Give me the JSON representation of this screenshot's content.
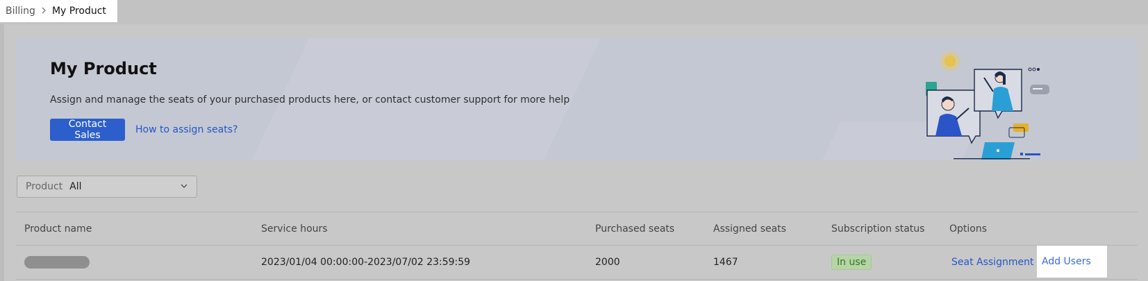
{
  "breadcrumb": {
    "parent": "Billing",
    "current": "My Product"
  },
  "banner": {
    "title": "My Product",
    "description": "Assign and manage the seats of your purchased products here, or contact customer support for more help",
    "contact_button": "Contact Sales",
    "help_link": "How to assign seats?"
  },
  "filter": {
    "label": "Product",
    "value": "All"
  },
  "table": {
    "headers": {
      "product_name": "Product name",
      "service_hours": "Service hours",
      "purchased_seats": "Purchased seats",
      "assigned_seats": "Assigned seats",
      "subscription_status": "Subscription status",
      "options": "Options"
    },
    "rows": [
      {
        "service_hours": "2023/01/04 00:00:00-2023/07/02 23:59:59",
        "purchased_seats": "2000",
        "assigned_seats": "1467",
        "status": "In use",
        "seat_assignment": "Seat Assignment",
        "add_users": "Add Users"
      }
    ]
  },
  "colors": {
    "primary": "#2c5fcc",
    "link": "#2456c8",
    "status_green": "#2d7a22",
    "overlay": "#c8c8c8"
  }
}
